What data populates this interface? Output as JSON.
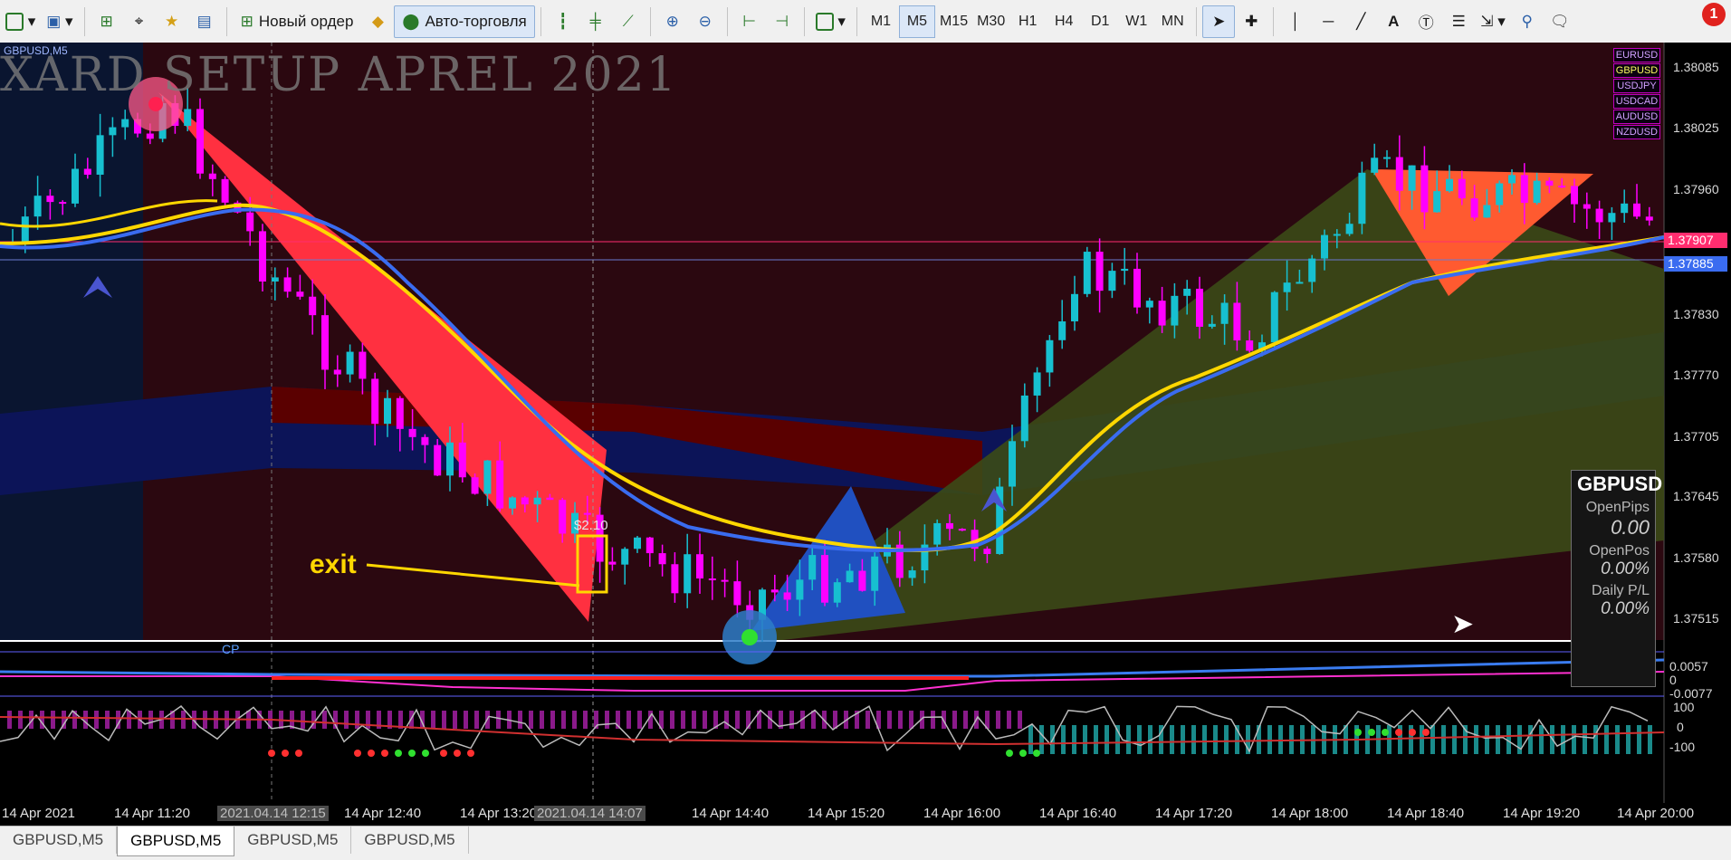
{
  "toolbar": {
    "new_order_label": "Новый ордер",
    "auto_trading_label": "Авто-торговля",
    "timeframes": [
      "M1",
      "M5",
      "M15",
      "M30",
      "H1",
      "H4",
      "D1",
      "W1",
      "MN"
    ],
    "active_timeframe": "M5",
    "notification_count": "1"
  },
  "chart": {
    "symbol_label": "GBPUSD,M5",
    "watermark_title": "XARD SETUP APREL 2021",
    "exit_annotation": "exit",
    "profit_label": "$2.10",
    "cp_label": "CP",
    "price_axis": [
      "1.38085",
      "1.38025",
      "1.37960",
      "1.37830",
      "1.37770",
      "1.37705",
      "1.37645",
      "1.37580",
      "1.37515"
    ],
    "bid_price": "1.37907",
    "ask_price": "1.37885",
    "pair_tags": [
      "EURUSD",
      "GBPUSD",
      "USDJPY",
      "USDCAD",
      "AUDUSD",
      "NZDUSD"
    ],
    "sub1_axis": [
      "0.0057",
      "0",
      "-0.0077"
    ],
    "sub2_axis": [
      "100",
      "0",
      "-100"
    ],
    "time_axis": [
      "14 Apr 2021",
      "14 Apr 11:20",
      "2021.04.14 12:15",
      "14 Apr 12:40",
      "14 Apr 13:20",
      "2021.04.14 14:07",
      "14 Apr 14:40",
      "14 Apr 15:20",
      "14 Apr 16:00",
      "14 Apr 16:40",
      "14 Apr 17:20",
      "14 Apr 18:00",
      "14 Apr 18:40",
      "14 Apr 19:20",
      "14 Apr 20:00"
    ],
    "colors": {
      "background": "#000000",
      "bull": "#17c0d0",
      "bear": "#ff00ff",
      "ma_fast": "#ffd700",
      "ma_slow": "#3a6cf0"
    }
  },
  "panel": {
    "symbol": "GBPUSD",
    "open_pips_label": "OpenPips",
    "open_pips_value": "0.00",
    "open_pos_label": "OpenPos",
    "open_pos_value": "0.00%",
    "daily_pl_label": "Daily P/L",
    "daily_pl_value": "0.00%"
  },
  "tabs": [
    "GBPUSD,M5",
    "GBPUSD,M5",
    "GBPUSD,M5",
    "GBPUSD,M5"
  ],
  "active_tab": 1
}
